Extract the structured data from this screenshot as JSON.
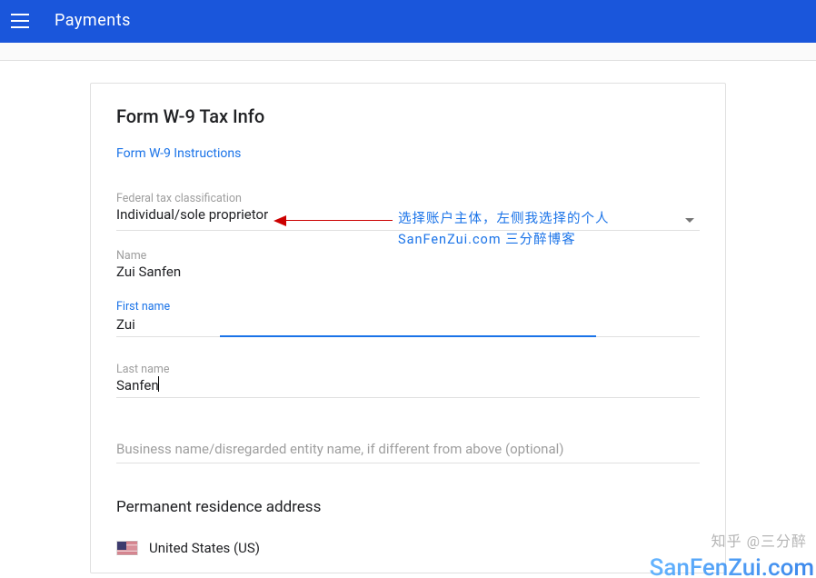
{
  "app": {
    "title": "Payments"
  },
  "form": {
    "heading": "Form W-9 Tax Info",
    "instructions_link": "Form W-9 Instructions",
    "classification": {
      "label": "Federal tax classification",
      "value": "Individual/sole proprietor"
    },
    "name": {
      "label": "Name",
      "value": "Zui Sanfen"
    },
    "first_name": {
      "label": "First name",
      "value": "Zui"
    },
    "last_name": {
      "label": "Last name",
      "value": "Sanfen"
    },
    "business_name": {
      "placeholder": "Business name/disregarded entity name, if different from above (optional)"
    },
    "address_heading": "Permanent residence address",
    "country": {
      "label": "United States (US)",
      "code": "US"
    }
  },
  "annotation": {
    "line1": "选择账户主体，左侧我选择的个人",
    "line2": "SanFenZui.com 三分醉博客"
  },
  "watermark": {
    "zhihu": "知乎 @三分醉",
    "site": "SanFenZui.com"
  }
}
